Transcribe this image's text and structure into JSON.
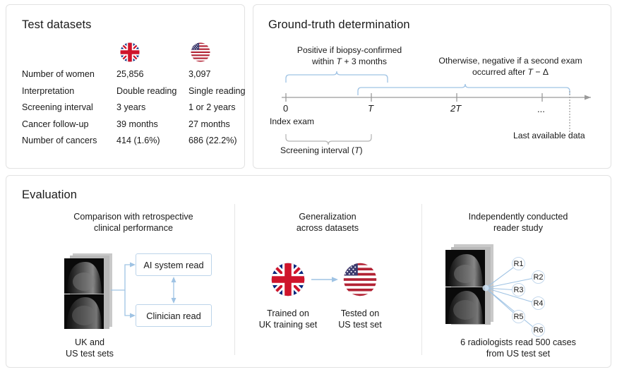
{
  "panels": {
    "datasets": {
      "title": "Test datasets"
    },
    "ground_truth": {
      "title": "Ground-truth determination"
    },
    "evaluation": {
      "title": "Evaluation"
    }
  },
  "datasets_table": {
    "columns": [
      {
        "key": "label",
        "header": ""
      },
      {
        "key": "uk",
        "header": "uk-flag-icon"
      },
      {
        "key": "us",
        "header": "us-flag-icon"
      }
    ],
    "rows": [
      {
        "label": "Number of women",
        "uk": "25,856",
        "us": "3,097"
      },
      {
        "label": "Interpretation",
        "uk": "Double reading",
        "us": "Single reading"
      },
      {
        "label": "Screening interval",
        "uk": "3 years",
        "us": "1 or 2 years"
      },
      {
        "label": "Cancer follow-up",
        "uk": "39 months",
        "us": "27 months"
      },
      {
        "label": "Number of cancers",
        "uk": "414 (1.6%)",
        "us": "686 (22.2%)"
      }
    ]
  },
  "ground_truth": {
    "note_positive_line1": "Positive if biopsy-confirmed",
    "note_positive_line2_pre": "within ",
    "note_positive_line2_var": "T",
    "note_positive_line2_post": " + 3 months",
    "note_negative_line1": "Otherwise, negative if a second exam",
    "note_negative_line2_pre": "occurred after ",
    "note_negative_line2_var": "T",
    "note_negative_line2_post": " − Δ",
    "tick_labels": [
      "0",
      "T",
      "2T",
      "..."
    ],
    "index_exam_label": "Index exam",
    "last_available_label": "Last available data",
    "screening_interval_label_pre": "Screening interval (",
    "screening_interval_label_var": "T",
    "screening_interval_label_post": ")"
  },
  "evaluation": {
    "columns": [
      {
        "title_line1": "Comparison with retrospective",
        "title_line2": "clinical performance",
        "caption_line1": "UK and",
        "caption_line2": "US test sets",
        "box_ai": "AI system read",
        "box_clinician": "Clinician read"
      },
      {
        "title_line1": "Generalization",
        "title_line2": "across datasets",
        "caption_uk_line1": "Trained on",
        "caption_uk_line2": "UK training set",
        "caption_us_line1": "Tested on",
        "caption_us_line2": "US test set"
      },
      {
        "title_line1": "Independently conducted",
        "title_line2": "reader study",
        "readers": [
          "R1",
          "R2",
          "R3",
          "R4",
          "R5",
          "R6"
        ],
        "caption_line1": "6 radiologists read 500 cases",
        "caption_line2": "from US test set"
      }
    ]
  },
  "colors": {
    "panel_border": "#e2e2e2",
    "accent_blue": "#9fc3e4",
    "box_border": "#bcd4ea",
    "axis_gray": "#9a9a9a",
    "text": "#1a1a1a",
    "uk_red": "#cf142b",
    "uk_blue": "#00247d",
    "us_red": "#b22234",
    "us_blue": "#3c3b6e"
  }
}
